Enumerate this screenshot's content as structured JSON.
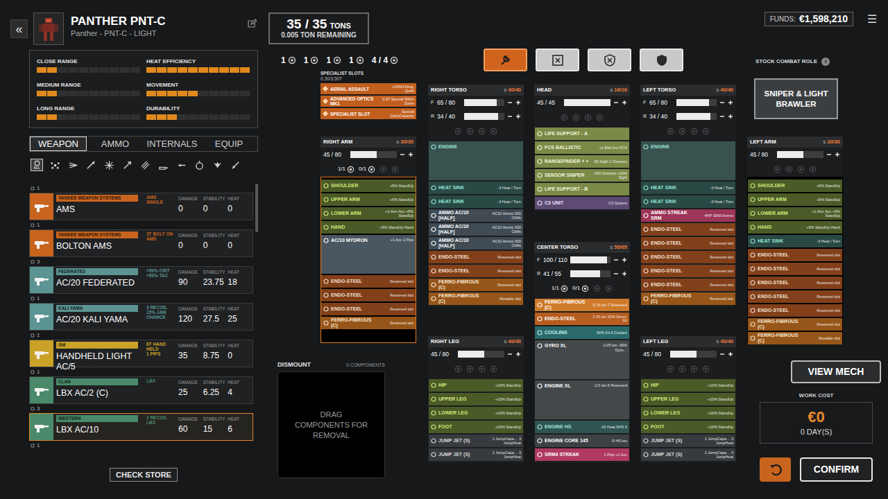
{
  "header": {
    "back": "«",
    "title": "PANTHER PNT-C",
    "subtitle": "Panther - PNT-C - LIGHT"
  },
  "stats": [
    {
      "label": "CLOSE RANGE",
      "level": 0.2
    },
    {
      "label": "HEAT EFFICIENCY",
      "level": 1.0
    },
    {
      "label": "MEDIUM RANGE",
      "level": 0.2
    },
    {
      "label": "MOVEMENT",
      "level": 0.5
    },
    {
      "label": "LONG RANGE",
      "level": 0.2
    },
    {
      "label": "DURABILITY",
      "level": 0.3
    }
  ],
  "tabs": [
    {
      "label": "WEAPON",
      "selected": true
    },
    {
      "label": "AMMO",
      "selected": false
    },
    {
      "label": "INTERNALS",
      "selected": false
    },
    {
      "label": "EQUIP",
      "selected": false
    }
  ],
  "filters": [
    {
      "label": "ALL",
      "selected": true
    },
    {
      "selected": false
    },
    {
      "selected": false
    },
    {
      "selected": false
    },
    {
      "selected": false
    },
    {
      "selected": false
    },
    {
      "selected": false
    },
    {
      "selected": false
    },
    {
      "selected": false
    },
    {
      "selected": false
    },
    {
      "selected": false
    },
    {
      "selected": false
    }
  ],
  "stat_labels": [
    "DAMAGE",
    "STABILITY",
    "HEAT"
  ],
  "weapons": [
    {
      "count": "1",
      "maker": "YANKEE WEAPON SYSTEMS",
      "name": "AMS",
      "special": [
        "AMS",
        "SINGLE"
      ],
      "damage": "0",
      "stability": "0",
      "heat": "0",
      "color": "#c8641e",
      "selected": false
    },
    {
      "count": "1",
      "maker": "YANKEE WEAPON SYSTEMS",
      "name": "BOLTON AMS",
      "special": [
        "3T BOLT ON",
        "AMS"
      ],
      "damage": "0",
      "stability": "0",
      "heat": "0",
      "color": "#c8641e",
      "selected": false
    },
    {
      "count": "3",
      "maker": "FEDERATED",
      "name": "AC/20 FEDERATED",
      "special": [
        "+50% CRIT",
        "+50% TAC"
      ],
      "damage": "90",
      "stability": "23.75",
      "heat": "18",
      "color": "#5b9493",
      "selected": false
    },
    {
      "count": "1",
      "maker": "KALI YAMA",
      "name": "AC/20 KALI YAMA",
      "special": [
        "3 RECOIL",
        "15% JAM",
        "CHANCE"
      ],
      "damage": "120",
      "stability": "27.5",
      "heat": "25",
      "color": "#5b9493",
      "selected": false
    },
    {
      "count": "1",
      "maker": "GM",
      "name": "HANDHELD LIGHT AC/5",
      "special": [
        "6T HAND HELD",
        "1 PIPS"
      ],
      "damage": "35",
      "stability": "8.75",
      "heat": "0",
      "color": "#c9a227",
      "selected": false
    },
    {
      "count": "1",
      "maker": "CLAN",
      "name": "LBX AC/2 (C)",
      "special": [
        "LBX"
      ],
      "damage": "25",
      "stability": "6.25",
      "heat": "4",
      "color": "#4a8a6a",
      "selected": false
    },
    {
      "count": "3",
      "maker": "WESTERN",
      "name": "LBX AC/10",
      "special": [
        "2 RECOIL",
        "LBX"
      ],
      "damage": "60",
      "stability": "15",
      "heat": "6",
      "color": "#4a8a6a",
      "selected": true
    }
  ],
  "weapons_more": {
    "count": "1"
  },
  "check_store": "CHECK STORE",
  "tonnage": {
    "current": "35 / 35",
    "unit": "TONS",
    "remaining": "0.005 TON REMAINING"
  },
  "hardpoints": [
    {
      "text": "1"
    },
    {
      "text": "1"
    },
    {
      "text": "1"
    },
    {
      "text": "1"
    },
    {
      "text": "4 / 4"
    }
  ],
  "tools": [
    {
      "selected": true
    },
    {
      "selected": false
    },
    {
      "selected": false
    },
    {
      "selected": false
    }
  ],
  "funds": {
    "label": "FUNDS:",
    "value": "€1,598,210"
  },
  "menu": "☰",
  "combat_role": {
    "label": "STOCK COMBAT ROLE",
    "info": "i",
    "value": "SNIPER & LIGHT BRAWLER"
  },
  "specialist": {
    "title": "SPECIALIST SLOTS",
    "capacity": "0.30/3.50T",
    "slots": [
      {
        "name": "AERIAL ASSAULT",
        "detail": "+10%J.Dmg. Quirk"
      },
      {
        "name": "ADVANCED OPTICS MK1",
        "detail": "0.3T Special 540m Zoom"
      },
      {
        "name": "SPECIALIST SLOT",
        "detail": "Special CarryCapacity"
      }
    ]
  },
  "components": {
    "right_arm": {
      "name": "RIGHT ARM",
      "slots_label": "S",
      "capacity": "30/30",
      "selected": true,
      "armor": [
        {
          "value": "45 / 80",
          "level": 0.5625
        }
      ],
      "hardpoints": [
        {
          "text": "1/1"
        },
        {
          "text": "0/1"
        }
      ],
      "items": [
        {
          "name": "SHOULDER",
          "detail": "+5% StandUp",
          "kind": "actuator"
        },
        {
          "name": "UPPER ARM",
          "detail": "+5% StandUp",
          "kind": "actuator"
        },
        {
          "name": "LOWER ARM",
          "detail": "+1 Arm Acc +5% StandUp",
          "kind": "actuator"
        },
        {
          "name": "HAND",
          "detail": "+5% StandUp Hand",
          "kind": "actuator"
        },
        {
          "name": "AC/10 MYDRON",
          "detail": "+1 Acc 1 Pips",
          "kind": "weapon"
        },
        {
          "name": "ENDO-STEEL",
          "detail": "Reserved slot",
          "kind": "endo"
        },
        {
          "name": "ENDO-STEEL",
          "detail": "Reserved slot",
          "kind": "endo"
        },
        {
          "name": "ENDO-STEEL",
          "detail": "Reserved slot",
          "kind": "endo"
        },
        {
          "name": "FERRO-FIBROUS (C)",
          "detail": "Reserved slot",
          "kind": "ferro"
        }
      ]
    },
    "right_torso": {
      "name": "RIGHT TORSO",
      "slots_label": "S",
      "capacity": "40/40",
      "selected": false,
      "armor": [
        {
          "label": "F",
          "value": "65 / 80",
          "level": 0.8125
        },
        {
          "label": "R",
          "value": "34 / 40",
          "level": 0.85
        }
      ],
      "hardpoints": [],
      "items": [
        {
          "name": "ENGINE",
          "kind": "engine"
        },
        {
          "name": "HEAT SINK",
          "detail": "-3 Heat / Turn",
          "kind": "heatsink"
        },
        {
          "name": "HEAT SINK",
          "detail": "-3 Heat / Turn",
          "kind": "heatsink"
        },
        {
          "name": "AMMO AC/10 [HALF]",
          "detail": "AC10 Ammo 300 Cbills",
          "kind": "ammo"
        },
        {
          "name": "AMMO AC/10 [HALF]",
          "detail": "AC10 Ammo 300 Cbills",
          "kind": "ammo"
        },
        {
          "name": "AMMO AC/10 [HALF]",
          "detail": "AC10 Ammo 300 Cbills",
          "kind": "ammo"
        },
        {
          "name": "ENDO-STEEL",
          "detail": "Reserved slot",
          "kind": "endo"
        },
        {
          "name": "ENDO-STEEL",
          "detail": "Reserved slot",
          "kind": "endo"
        },
        {
          "name": "FERRO-FIBROUS (C)",
          "detail": "Reserved slot",
          "kind": "ferro"
        },
        {
          "name": "FERRO-FIBROUS (C)",
          "detail": "Movable slot",
          "kind": "ferro"
        }
      ]
    },
    "head": {
      "name": "HEAD",
      "slots_label": "S",
      "capacity": "16/16",
      "selected": false,
      "armor": [
        {
          "value": "45 / 45",
          "level": 1.0
        }
      ],
      "hardpoints": [],
      "items": [
        {
          "name": "LIFE SUPPORT - A",
          "kind": "electronics"
        },
        {
          "name": "FCS BALLISTIC",
          "detail": "+1 Ball.Acc FCS",
          "kind": "electronics"
        },
        {
          "name": "RANGEFINDER + +",
          "detail": "80 Sight 1 Gunnery",
          "kind": "electronics"
        },
        {
          "name": "SENSOR SNIPER",
          "detail": "+5% Sensors +10% Sight",
          "kind": "electronics"
        },
        {
          "name": "LIFE SUPPORT - B",
          "kind": "electronics"
        },
        {
          "name": "C3 UNIT",
          "detail": "C3 System",
          "kind": "c3"
        }
      ]
    },
    "center_torso": {
      "name": "CENTER TORSO",
      "slots_label": "S",
      "capacity": "55/65",
      "selected": false,
      "armor": [
        {
          "label": "F",
          "value": "100 / 110",
          "level": 0.909
        },
        {
          "label": "R",
          "value": "41 / 55",
          "level": 0.745
        }
      ],
      "hardpoints": [
        {
          "text": "1/1"
        },
        {
          "text": "0/1"
        }
      ],
      "items": [
        {
          "name": "FERRO-FIBROUS (C)",
          "detail": "0.76 ton 7 Reserved",
          "kind": "ferro-core"
        },
        {
          "name": "ENDO-STEEL",
          "detail": "1.76 ton 15% Struct. TP",
          "kind": "endo-core"
        },
        {
          "name": "COOLING",
          "detail": "SHS Kit 5 Coolant",
          "kind": "cooling"
        },
        {
          "name": "GYRO XL",
          "detail": "-1.05 ton -30% Gyro…",
          "kind": "gyro"
        },
        {
          "name": "ENGINE XL",
          "detail": "-2.5 ton 6 Reserved",
          "kind": "engine-xl"
        },
        {
          "name": "ENGINE HS",
          "detail": "-15 Heat SHS 5",
          "kind": "engine-hs"
        },
        {
          "name": "ENGINE CORE 145",
          "detail": "-5 HS ton",
          "kind": "engine-core"
        },
        {
          "name": "SRM4 STREAK",
          "detail": "1 Pips +1 Acc",
          "kind": "missile"
        }
      ]
    },
    "left_torso": {
      "name": "LEFT TORSO",
      "slots_label": "S",
      "capacity": "40/40",
      "selected": false,
      "armor": [
        {
          "label": "F",
          "value": "65 / 80",
          "level": 0.8125
        },
        {
          "label": "R",
          "value": "34 / 40",
          "level": 0.85
        }
      ],
      "hardpoints": [],
      "items": [
        {
          "name": "ENGINE",
          "kind": "engine"
        },
        {
          "name": "HEAT SINK",
          "detail": "-3 Heat / Turn",
          "kind": "heatsink"
        },
        {
          "name": "HEAT SINK",
          "detail": "-3 Heat / Turn",
          "kind": "heatsink"
        },
        {
          "name": "AMMO STREAK SRM",
          "detail": "4HP SRM Ammo",
          "kind": "missile-ammo"
        },
        {
          "name": "ENDO-STEEL",
          "detail": "Reserved slot",
          "kind": "endo"
        },
        {
          "name": "ENDO-STEEL",
          "detail": "Reserved slot",
          "kind": "endo"
        },
        {
          "name": "ENDO-STEEL",
          "detail": "Reserved slot",
          "kind": "endo"
        },
        {
          "name": "ENDO-STEEL",
          "detail": "Reserved slot",
          "kind": "endo"
        },
        {
          "name": "ENDO-STEEL",
          "detail": "Reserved slot",
          "kind": "endo"
        },
        {
          "name": "FERRO-FIBROUS (C)",
          "detail": "Reserved slot",
          "kind": "ferro"
        }
      ]
    },
    "left_arm": {
      "name": "LEFT ARM",
      "slots_label": "S",
      "capacity": "30/30",
      "selected": false,
      "armor": [
        {
          "value": "45 / 80",
          "level": 0.5625
        }
      ],
      "hardpoints": [],
      "items": [
        {
          "name": "SHOULDER",
          "detail": "+5% StandUp",
          "kind": "actuator"
        },
        {
          "name": "UPPER ARM",
          "detail": "+5% StandUp",
          "kind": "actuator"
        },
        {
          "name": "LOWER ARM",
          "detail": "+1 Arm Acc +5% StandUp",
          "kind": "actuator"
        },
        {
          "name": "HAND",
          "detail": "+5% StandUp Hand",
          "kind": "actuator"
        },
        {
          "name": "HEAT SINK",
          "detail": "-3 Heat / Turn",
          "kind": "heatsink"
        },
        {
          "name": "ENDO-STEEL",
          "detail": "Reserved slot",
          "kind": "endo"
        },
        {
          "name": "ENDO-STEEL",
          "detail": "Reserved slot",
          "kind": "endo"
        },
        {
          "name": "ENDO-STEEL",
          "detail": "Reserved slot",
          "kind": "endo"
        },
        {
          "name": "ENDO-STEEL",
          "detail": "Reserved slot",
          "kind": "endo"
        },
        {
          "name": "ENDO-STEEL",
          "detail": "Reserved slot",
          "kind": "endo"
        },
        {
          "name": "FERRO-FIBROUS (C)",
          "detail": "Reserved slot",
          "kind": "ferro"
        },
        {
          "name": "FERRO-FIBROUS (C)",
          "detail": "Movable slot",
          "kind": "ferro"
        }
      ]
    },
    "right_leg": {
      "name": "RIGHT LEG",
      "slots_label": "S",
      "capacity": "40/40",
      "selected": false,
      "armor": [
        {
          "value": "45 / 80",
          "level": 0.5625
        }
      ],
      "hardpoints": [],
      "items": [
        {
          "name": "HIP",
          "detail": "+10% StandUp",
          "kind": "actuator"
        },
        {
          "name": "UPPER LEG",
          "detail": "+10% StandUp",
          "kind": "actuator"
        },
        {
          "name": "LOWER LEG",
          "detail": "+10% StandUp",
          "kind": "actuator"
        },
        {
          "name": "FOOT",
          "detail": "+10% StandUp",
          "kind": "actuator"
        },
        {
          "name": "JUMP JET (S)",
          "detail": "1 JumpCapa… 3 JumpHeat",
          "kind": "jumpjet"
        },
        {
          "name": "JUMP JET (S)",
          "detail": "1 JumpCapa… 3 JumpHeat",
          "kind": "jumpjet"
        }
      ]
    },
    "left_leg": {
      "name": "LEFT LEG",
      "slots_label": "S",
      "capacity": "40/40",
      "selected": false,
      "armor": [
        {
          "value": "45 / 80",
          "level": 0.5625
        }
      ],
      "hardpoints": [],
      "items": [
        {
          "name": "HIP",
          "detail": "+10% StandUp",
          "kind": "actuator"
        },
        {
          "name": "UPPER LEG",
          "detail": "+10% StandUp",
          "kind": "actuator"
        },
        {
          "name": "LOWER LEG",
          "detail": "+10% StandUp",
          "kind": "actuator"
        },
        {
          "name": "FOOT",
          "detail": "+10% StandUp",
          "kind": "actuator"
        },
        {
          "name": "JUMP JET (S)",
          "detail": "1 JumpCapa… 3 JumpHeat",
          "kind": "jumpjet"
        },
        {
          "name": "JUMP JET (S)",
          "detail": "1 JumpCapa… 3 JumpHeat",
          "kind": "jumpjet"
        }
      ]
    }
  },
  "dismount": {
    "title": "DISMOUNT",
    "count": "0 COMPONENTS",
    "hint": "DRAG COMPONENTS FOR REMOVAL"
  },
  "view_mech": "VIEW MECH",
  "work_cost": {
    "label": "WORK COST",
    "value": "€0",
    "days": "0 DAY(S)"
  },
  "confirm": "CONFIRM"
}
